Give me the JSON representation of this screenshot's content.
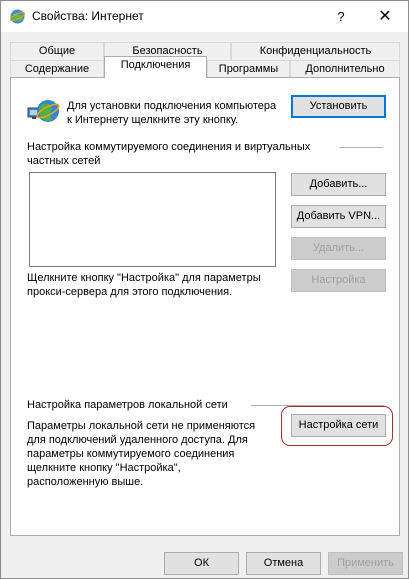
{
  "window": {
    "title": "Свойства: Интернет",
    "help_glyph": "?",
    "close_glyph": "✕"
  },
  "tabs": {
    "row1": [
      "Общие",
      "Безопасность",
      "Конфиденциальность"
    ],
    "row2": [
      "Содержание",
      "Подключения",
      "Программы",
      "Дополнительно"
    ],
    "active": "Подключения"
  },
  "setup": {
    "text_line1": "Для установки подключения компьютера",
    "text_line2": "к Интернету щелкните эту кнопку.",
    "button": "Установить"
  },
  "vpn": {
    "section_line1": "Настройка коммутируемого соединения и виртуальных",
    "section_line2": "частных сетей",
    "add_button": "Добавить...",
    "add_vpn_button": "Добавить VPN...",
    "remove_button": "Удалить...",
    "settings_button": "Настройка",
    "proxy_line1": "Щелкните кнопку \"Настройка\" для параметры",
    "proxy_line2": "прокси-сервера для этого подключения."
  },
  "lan": {
    "section_title": "Настройка параметров локальной сети",
    "text_lines": [
      "Параметры локальной сети не применяются",
      "для подключений удаленного доступа. Для",
      "параметры коммутируемого соединения",
      "щелкните кнопку \"Настройка\",",
      "расположенную выше."
    ],
    "button": "Настройка сети"
  },
  "footer": {
    "ok": "ОК",
    "cancel": "Отмена",
    "apply": "Применить"
  },
  "colors": {
    "highlight_ring": "#a13232",
    "default_button_border": "#0078d7"
  }
}
